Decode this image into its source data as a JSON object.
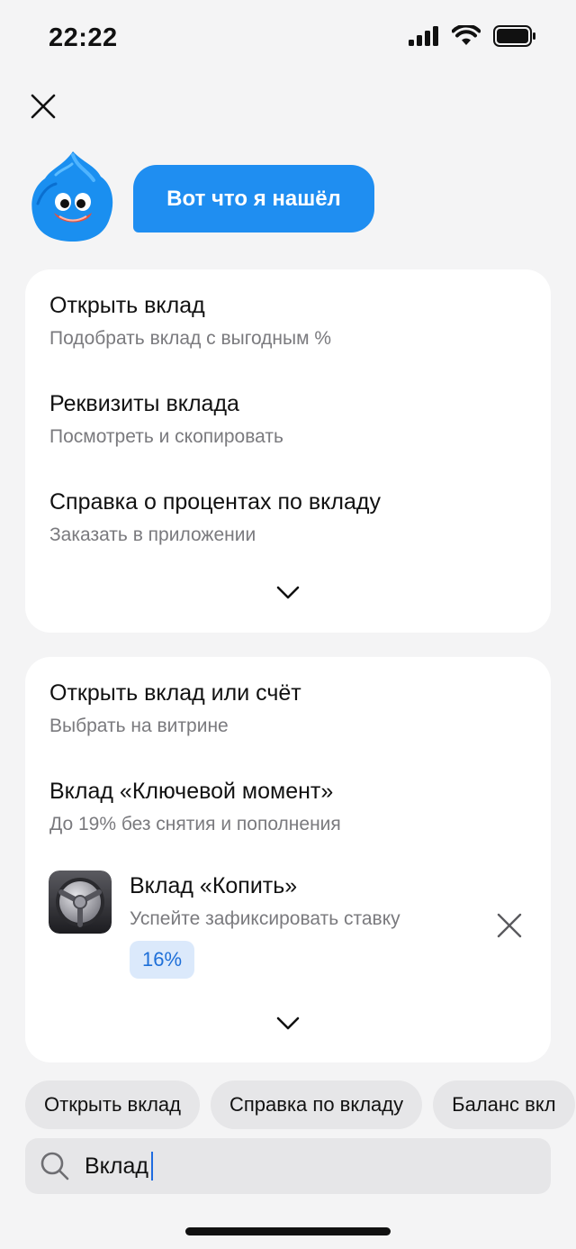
{
  "status": {
    "time": "22:22"
  },
  "assistant": {
    "message": "Вот что я нашёл"
  },
  "card1": {
    "items": [
      {
        "title": "Открыть вклад",
        "subtitle": "Подобрать вклад с выгодным %"
      },
      {
        "title": "Реквизиты вклада",
        "subtitle": "Посмотреть и скопировать"
      },
      {
        "title": "Справка о процентах по вкладу",
        "subtitle": "Заказать в приложении"
      }
    ]
  },
  "card2": {
    "items": [
      {
        "title": "Открыть вклад или счёт",
        "subtitle": "Выбрать на витрине"
      },
      {
        "title": "Вклад «Ключевой момент»",
        "subtitle": "До 19% без снятия и пополнения"
      }
    ],
    "product": {
      "title": "Вклад «Копить»",
      "subtitle": "Успейте зафиксировать ставку",
      "badge": "16%"
    }
  },
  "chips": [
    "Открыть вклад",
    "Справка по вкладу",
    "Баланс вкл"
  ],
  "search": {
    "value": "Вклад"
  },
  "colors": {
    "accent": "#1f8ef1",
    "badge_bg": "#dbe9fb",
    "badge_text": "#1e6fd8"
  }
}
